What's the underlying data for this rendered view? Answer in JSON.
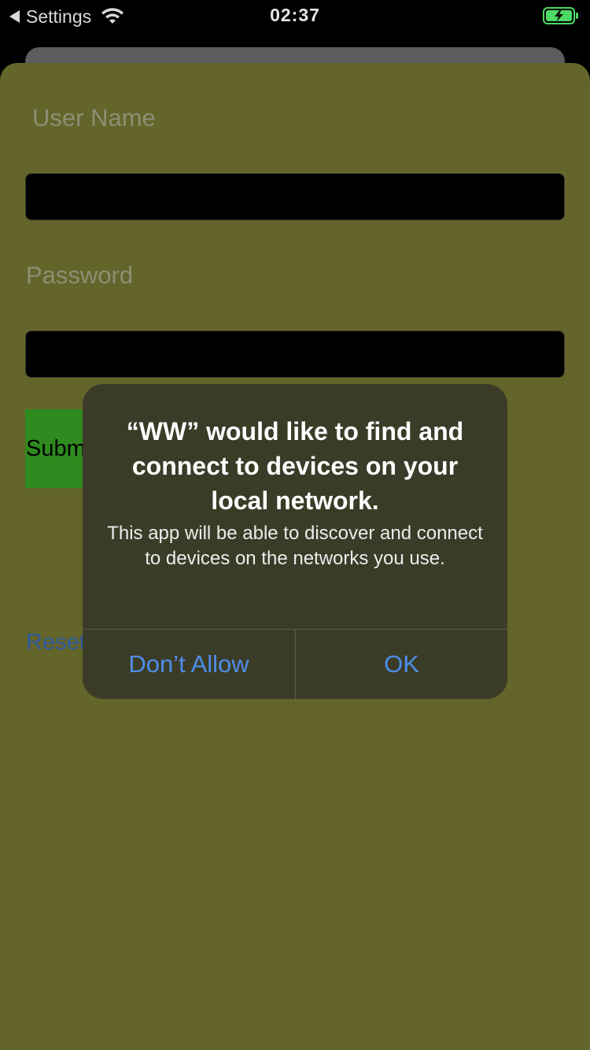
{
  "status_bar": {
    "back_label": "Settings",
    "time": "02:37",
    "icons": [
      "back-arrow-icon",
      "wifi-icon",
      "battery-charging-icon"
    ],
    "battery_color": "#4cd964"
  },
  "form": {
    "username_label": "User Name",
    "username_value": "",
    "password_label": "Password",
    "password_value": "",
    "submit_label": "Submit",
    "reset_label": "Reset"
  },
  "alert": {
    "title": "“WW” would like to find and connect to devices on your local network.",
    "message": "This app will be able to discover and connect to devices on the networks you use.",
    "deny_label": "Don’t Allow",
    "ok_label": "OK"
  },
  "colors": {
    "sheet_background": "#63652b",
    "submit_background": "#2f8a1f",
    "alert_background": "#3b3c28",
    "alert_button_text": "#4d8ee8",
    "reset_link": "#2f5a9c"
  }
}
